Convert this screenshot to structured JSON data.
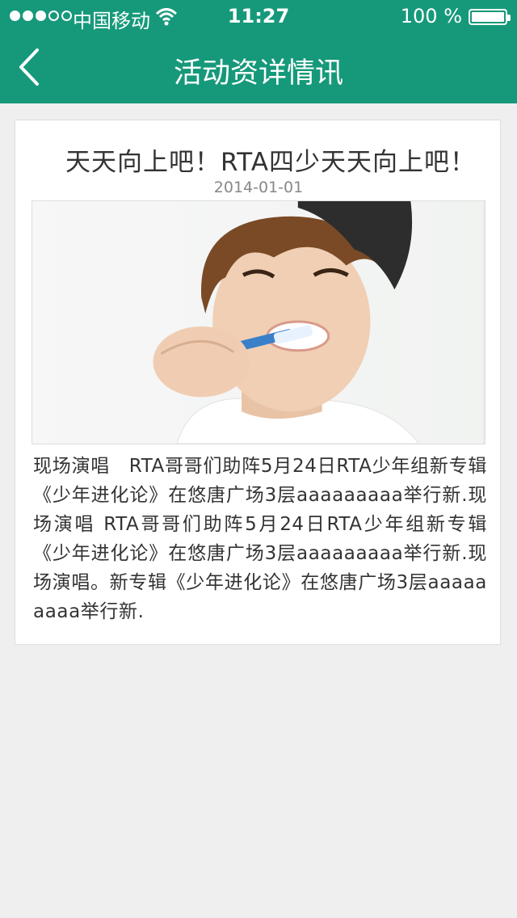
{
  "status_bar": {
    "carrier": "中国移动",
    "time": "11:27",
    "battery": "100 %",
    "battery_level": 1.0,
    "signal_bars": 3
  },
  "nav": {
    "title": "活动资详情讯",
    "back_icon": "chevron-left-icon"
  },
  "article": {
    "headline": "天天向上吧！RTA四少天天向上吧！",
    "date": "2014-01-01",
    "body": "现场演唱　RTA哥哥们助阵5月24日RTA少年组新专辑《少年进化论》在悠唐广场3层aaaaaaaaa举行新.现场演唱 RTA哥哥们助阵5月24日RTA少年组新专辑《少年进化论》在悠唐广场3层aaaaaaaaa举行新.现场演唱。新专辑《少年进化论》在悠唐广场3层aaaaaaaaa举行新."
  },
  "colors": {
    "accent": "#16997a",
    "background": "#efefef"
  }
}
